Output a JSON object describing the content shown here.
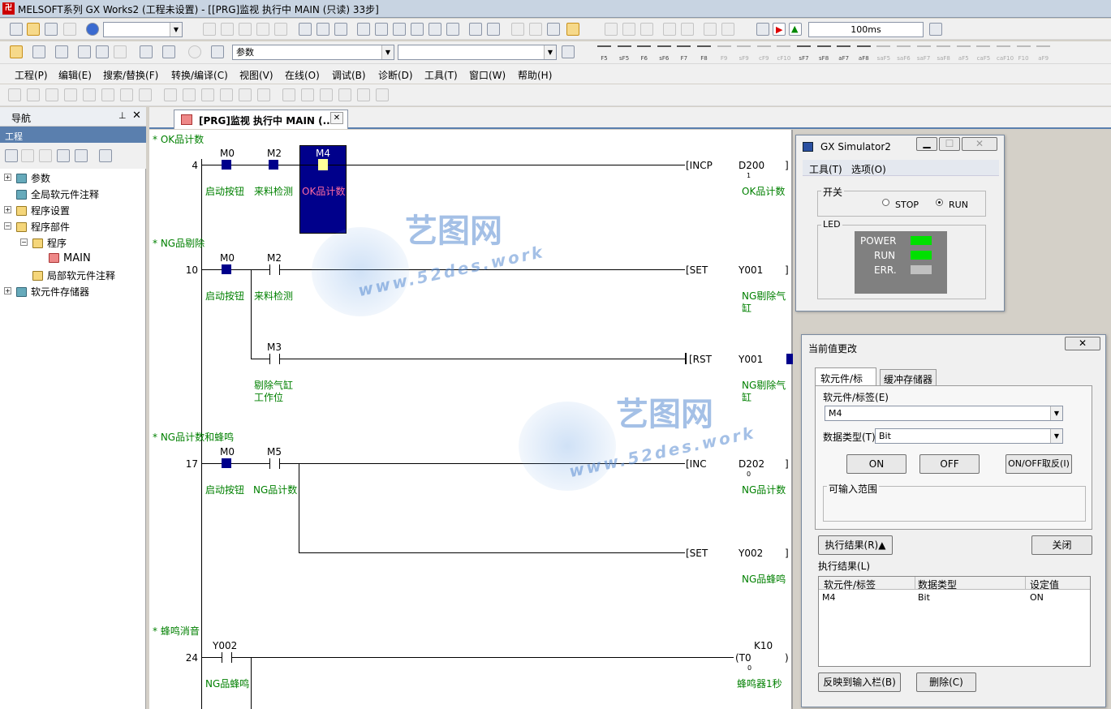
{
  "titlebar": {
    "title": "MELSOFT系列 GX Works2 (工程未设置) - [[PRG]监视 执行中 MAIN (只读) 33步]",
    "icon": "melsoft-app-icon"
  },
  "toolbar": {
    "scan_time": "100ms",
    "search_combo": "参数"
  },
  "fkeys": [
    "F5",
    "sF5",
    "F6",
    "sF6",
    "F7",
    "F8",
    "F9",
    "sF9",
    "cF9",
    "cF10",
    "sF7",
    "sF8",
    "aF7",
    "aF8",
    "saF5",
    "saF6",
    "saF7",
    "saF8",
    "aF5",
    "caF5",
    "caF10",
    "F10",
    "aF9"
  ],
  "menu": [
    "工程(P)",
    "编辑(E)",
    "搜索/替换(F)",
    "转换/编译(C)",
    "视图(V)",
    "在线(O)",
    "调试(B)",
    "诊断(D)",
    "工具(T)",
    "窗口(W)",
    "帮助(H)"
  ],
  "nav": {
    "title": "导航",
    "tab": "工程",
    "tree": [
      "参数",
      "全局软元件注释",
      "程序设置",
      "程序部件",
      "程序",
      "MAIN",
      "局部软元件注释",
      "软元件存储器"
    ]
  },
  "doc_tab": "[PRG]监视 执行中 MAIN (...",
  "ladder": {
    "r1": {
      "comment": "* OK品计数",
      "step": "4",
      "c1": "M0",
      "c2": "M2",
      "c3": "M4",
      "l1": "启动按钮",
      "l2": "来料检测",
      "l3": "OK品计数",
      "inst": "[INCP",
      "dest": "D200",
      "val": "1",
      "dl": "OK品计数"
    },
    "r2": {
      "comment": "* NG品剔除",
      "step": "10",
      "c1": "M0",
      "c2": "M2",
      "c3": "M3",
      "l1": "启动按钮",
      "l2": "来料检测",
      "l3a": "剔除气缸",
      "l3b": "工作位",
      "inst": "[SET",
      "dest": "Y001",
      "dla": "NG剔除气",
      "dlb": "缸",
      "inst2": "[RST",
      "dest2": "Y001",
      "dl2a": "NG剔除气",
      "dl2b": "缸"
    },
    "r3": {
      "comment": "* NG品计数和蜂鸣",
      "step": "17",
      "c1": "M0",
      "c2": "M5",
      "l1": "启动按钮",
      "l2": "NG品计数",
      "inst": "[INC",
      "dest": "D202",
      "val": "0",
      "dl": "NG品计数",
      "inst2": "[SET",
      "dest2": "Y002",
      "dl2": "NG品蜂鸣"
    },
    "r4": {
      "comment": "* 蜂鸣消音",
      "step": "24",
      "c1": "Y002",
      "l1": "NG品蜂鸣",
      "coil": "(T0",
      "kval": "K10",
      "val": "0",
      "dl": "蜂鸣器1秒"
    }
  },
  "simulator": {
    "title": "GX Simulator2",
    "menu": [
      "工具(T)",
      "选项(O)"
    ],
    "switch_label": "开关",
    "stop": "STOP",
    "run": "RUN",
    "led_label": "LED",
    "leds": [
      {
        "name": "POWER",
        "color": "#00e000"
      },
      {
        "name": "RUN",
        "color": "#00e000"
      },
      {
        "name": "ERR.",
        "color": "#c0c0c0"
      }
    ]
  },
  "cvc": {
    "title": "当前值更改",
    "tab1": "软元件/标签",
    "tab2": "缓冲存储器",
    "dev_label": "软元件/标签(E)",
    "dev_value": "M4",
    "type_label": "数据类型(T)",
    "type_value": "Bit",
    "btn_on": "ON",
    "btn_off": "OFF",
    "btn_toggle": "ON/OFF取反(I)",
    "range_label": "可输入范围",
    "btn_result": "执行结果(R)▲",
    "btn_close": "关闭",
    "result_label": "执行结果(L)",
    "cols": [
      "软元件/标签",
      "数据类型",
      "设定值"
    ],
    "row": [
      "M4",
      "Bit",
      "ON"
    ],
    "btn_reflect": "反映到输入栏(B)",
    "btn_delete": "删除(C)"
  },
  "watermark": {
    "cn": "艺图网",
    "url": "www.52des.work"
  }
}
